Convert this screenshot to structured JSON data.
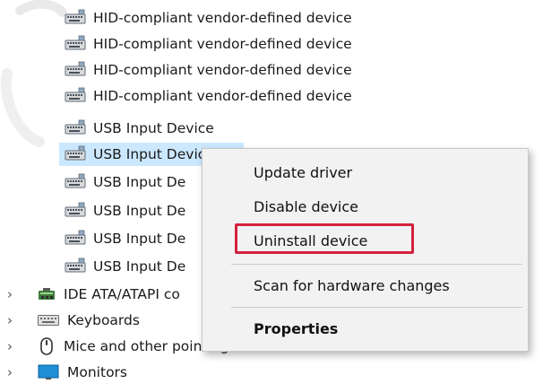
{
  "tree": {
    "devices": [
      {
        "label": "HID-compliant vendor-defined device",
        "selected": false
      },
      {
        "label": "HID-compliant vendor-defined device",
        "selected": false
      },
      {
        "label": "HID-compliant vendor-defined device",
        "selected": false
      },
      {
        "label": "HID-compliant vendor-defined device",
        "selected": false
      },
      {
        "label": "USB Input Device",
        "selected": false
      },
      {
        "label": "USB Input Device",
        "selected": true
      },
      {
        "label": "USB Input De",
        "selected": false
      },
      {
        "label": "USB Input De",
        "selected": false
      },
      {
        "label": "USB Input De",
        "selected": false
      },
      {
        "label": "USB Input De",
        "selected": false
      }
    ],
    "categories": [
      {
        "label": "IDE ATA/ATAPI co",
        "icon": "ide-controller-icon"
      },
      {
        "label": "Keyboards",
        "icon": "keyboard-icon"
      },
      {
        "label": "Mice and other pointing devices",
        "icon": "mouse-icon"
      },
      {
        "label": "Monitors",
        "icon": "monitor-icon"
      }
    ]
  },
  "context_menu": {
    "update_driver": "Update driver",
    "disable_device": "Disable device",
    "uninstall_device": "Uninstall device",
    "scan_hardware": "Scan for hardware changes",
    "properties": "Properties"
  },
  "colors": {
    "selection": "#cce8ff",
    "highlight_box": "#d4213d",
    "menu_bg": "#f2f2f2"
  }
}
